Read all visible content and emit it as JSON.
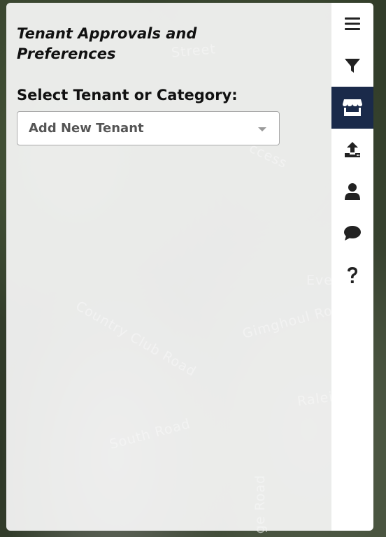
{
  "map": {
    "road_labels": [
      "Street",
      "ccess",
      "Country Club Road",
      "Gimghoul Ro",
      "Eve",
      "Ralei",
      "South Road",
      "ge Road"
    ]
  },
  "panel": {
    "title": "Tenant Approvals and Preferences",
    "select_label": "Select Tenant or Category:",
    "select_value": "Add New Tenant"
  },
  "tabs": [
    {
      "icon": "menu-icon",
      "active": false
    },
    {
      "icon": "filter-icon",
      "active": false
    },
    {
      "icon": "store-icon",
      "active": true
    },
    {
      "icon": "upload-icon",
      "active": false
    },
    {
      "icon": "user-icon",
      "active": false
    },
    {
      "icon": "comment-icon",
      "active": false
    },
    {
      "icon": "help-icon",
      "active": false
    }
  ],
  "colors": {
    "active_tab": "#1a2a4a",
    "panel_bg": "#f8f8f8"
  }
}
